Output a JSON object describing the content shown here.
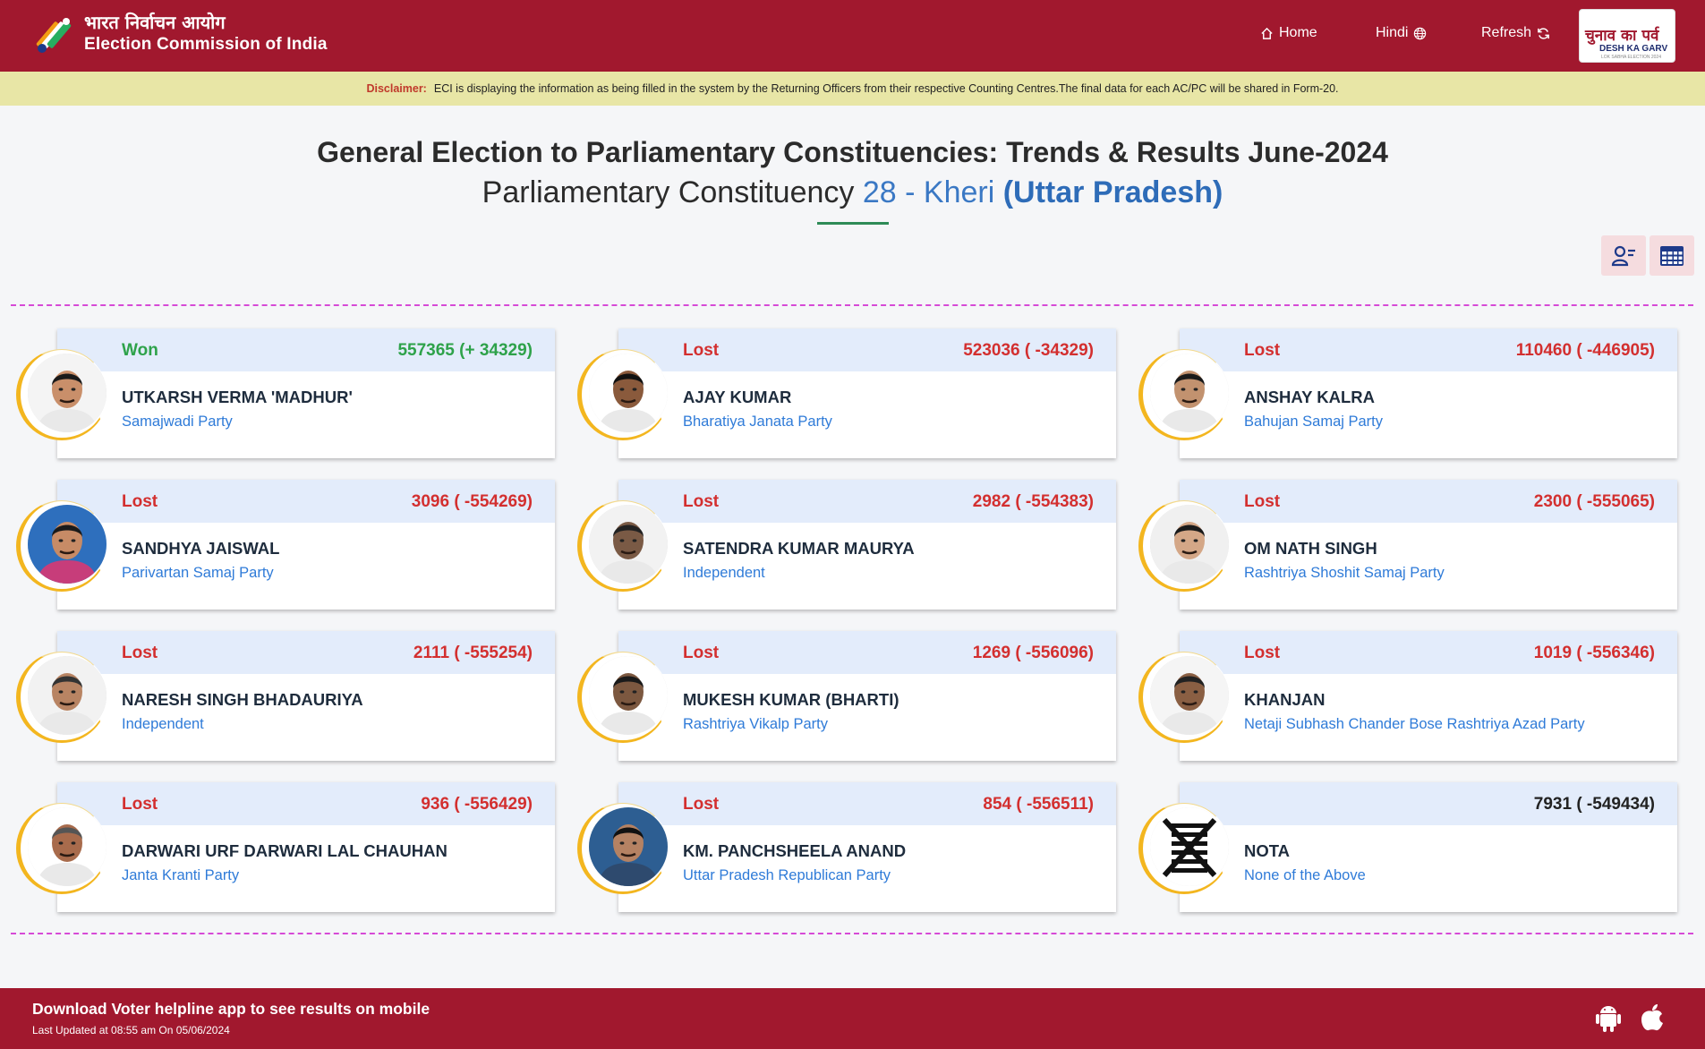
{
  "header": {
    "brand_hindi": "भारत निर्वाचन आयोग",
    "brand_english": "Election Commission of India",
    "nav": {
      "home": "Home",
      "hindi": "Hindi",
      "refresh": "Refresh"
    },
    "badge": {
      "hindi": "चुनाव का पर्व",
      "english": "DESH KA GARV",
      "small": "LOK SABHA ELECTION 2024"
    }
  },
  "disclaimer": {
    "label": "Disclaimer:",
    "text": "ECI is displaying the information as being filled in the system by the Returning Officers from their respective Counting Centres.The final data for each AC/PC will be shared in Form-20."
  },
  "title": {
    "line1": "General Election to Parliamentary Constituencies: Trends & Results June-2024",
    "line2_prefix": "Parliamentary Constituency",
    "line2_pc": "28 - Kheri",
    "line2_state": "(Uttar Pradesh)"
  },
  "colors": {
    "header": "#a1182e",
    "won": "#2ea24a",
    "lost": "#d32f2f",
    "party": "#2f7bd8",
    "ring": "#f3b61f"
  },
  "candidates": [
    {
      "status": "Won",
      "votes": "557365 (+ 34329)",
      "name": "UTKARSH VERMA 'MADHUR'",
      "party": "Samajwadi Party"
    },
    {
      "status": "Lost",
      "votes": "523036 ( -34329)",
      "name": "AJAY KUMAR",
      "party": "Bharatiya Janata Party"
    },
    {
      "status": "Lost",
      "votes": "110460 ( -446905)",
      "name": "ANSHAY KALRA",
      "party": "Bahujan Samaj Party"
    },
    {
      "status": "Lost",
      "votes": "3096 ( -554269)",
      "name": "SANDHYA JAISWAL",
      "party": "Parivartan Samaj Party"
    },
    {
      "status": "Lost",
      "votes": "2982 ( -554383)",
      "name": "SATENDRA KUMAR MAURYA",
      "party": "Independent"
    },
    {
      "status": "Lost",
      "votes": "2300 ( -555065)",
      "name": "OM NATH SINGH",
      "party": "Rashtriya Shoshit Samaj Party"
    },
    {
      "status": "Lost",
      "votes": "2111 ( -555254)",
      "name": "NARESH SINGH BHADAURIYA",
      "party": "Independent"
    },
    {
      "status": "Lost",
      "votes": "1269 ( -556096)",
      "name": "MUKESH KUMAR (BHARTI)",
      "party": "Rashtriya Vikalp Party"
    },
    {
      "status": "Lost",
      "votes": "1019 ( -556346)",
      "name": "KHANJAN",
      "party": "Netaji Subhash Chander Bose Rashtriya Azad Party"
    },
    {
      "status": "Lost",
      "votes": "936 ( -556429)",
      "name": "DARWARI URF DARWARI LAL CHAUHAN",
      "party": "Janta Kranti Party"
    },
    {
      "status": "Lost",
      "votes": "854 ( -556511)",
      "name": "KM. PANCHSHEELA ANAND",
      "party": "Uttar Pradesh Republican Party"
    },
    {
      "status": "",
      "votes": "7931 ( -549434)",
      "name": "NOTA",
      "party": "None of the Above"
    }
  ],
  "footer": {
    "download": "Download Voter helpline app to see results on mobile",
    "updated": "Last Updated at 08:55 am On 05/06/2024"
  }
}
